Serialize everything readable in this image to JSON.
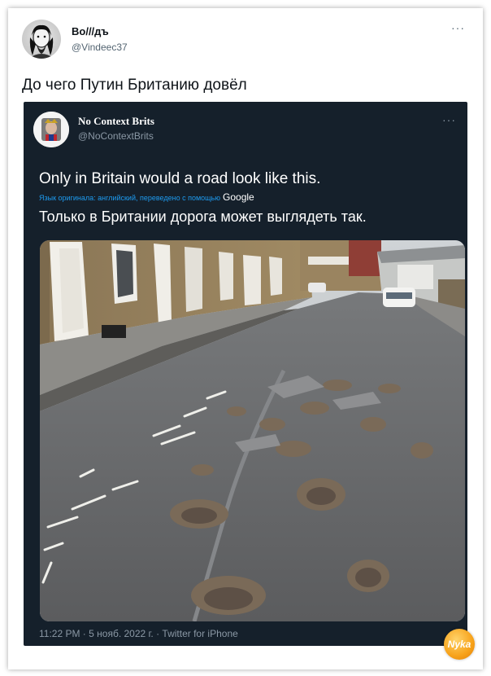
{
  "tweet": {
    "author_name": "Во///дъ",
    "author_handle": "@Vindeec37",
    "text": "До чего Путин Британию довёл",
    "more_glyph": "···"
  },
  "quoted_tweet": {
    "author_name": "No Context Brits",
    "author_handle": "@NoContextBrits",
    "more_glyph": "···",
    "text": "Only in Britain would a road look like this.",
    "translation_note": "Язык оригинала: английский, переведено с помощью",
    "translation_provider": "Google",
    "translated_text": "Только в Британии дорога может выглядеть так.",
    "timestamp": "11:22 PM · 5 нояб. 2022 г. · Twitter for iPhone"
  },
  "watermark": {
    "label": "Nyka"
  },
  "colors": {
    "dark_card": "#15202b",
    "accent_link": "#1d9bf0",
    "muted_text": "#8b98a5"
  }
}
